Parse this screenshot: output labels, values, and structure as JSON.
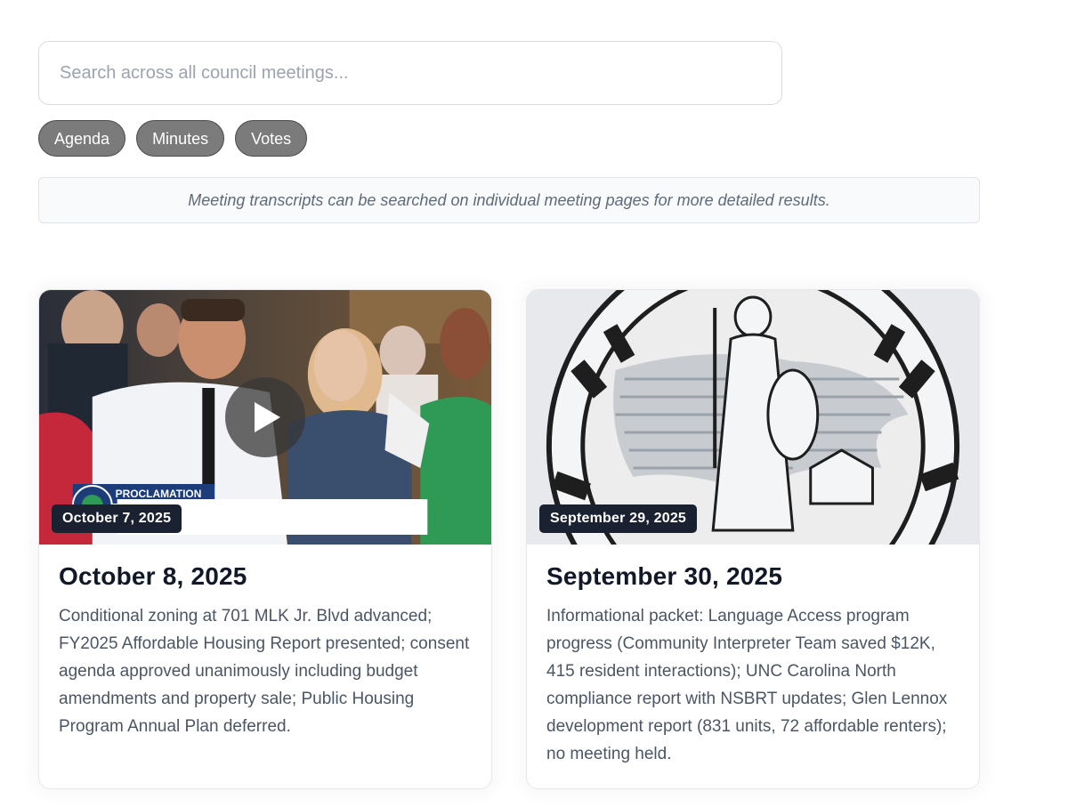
{
  "search": {
    "placeholder": "Search across all council meetings..."
  },
  "filters": [
    "Agenda",
    "Minutes",
    "Votes"
  ],
  "notice": "Meeting transcripts can be searched on individual meeting pages for more detailed results.",
  "meetings": [
    {
      "thumbnail_date": "October 7, 2025",
      "title": "October 8, 2025",
      "summary": "Conditional zoning at 701 MLK Jr. Blvd advanced; FY2025 Affordable Housing Report presented; consent agenda approved unanimously including budget amendments and property sale; Public Housing Program Annual Plan deferred.",
      "thumbnail_overlay_text": "PROCLAMATION",
      "has_video": true
    },
    {
      "thumbnail_date": "September 29, 2025",
      "title": "September 30, 2025",
      "summary": "Informational packet: Language Access program progress (Community Interpreter Team saved $12K, 415 resident interactions); UNC Carolina North compliance report with NSBRT updates; Glen Lennox development report (831 units, 72 affordable renters); no meeting held.",
      "thumbnail_overlay_text": "",
      "has_video": false
    }
  ],
  "icons": {
    "play": "play-icon",
    "seal": "town-seal-image",
    "photo": "meeting-photo"
  },
  "colors": {
    "badge_bg": "#1a2130",
    "chip_bg": "#7b7b7b",
    "notice_bg": "#f8fafc"
  }
}
